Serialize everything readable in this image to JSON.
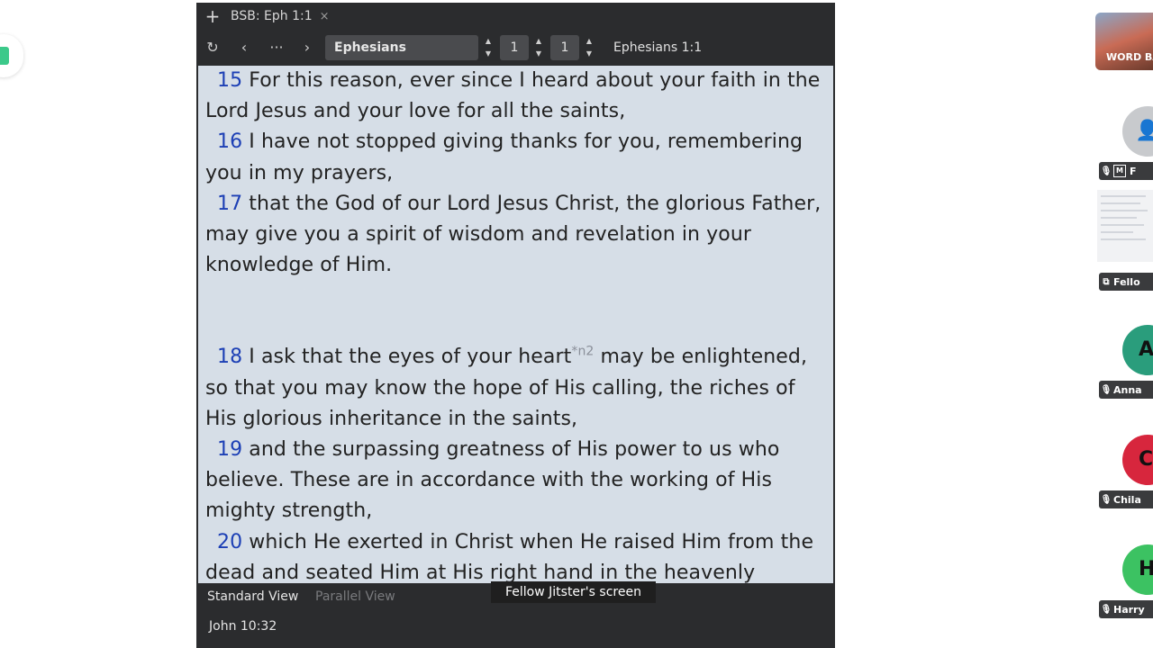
{
  "tab": {
    "title": "BSB: Eph 1:1",
    "close": "×",
    "new": "+"
  },
  "toolbar": {
    "book": "Ephesians",
    "chapter": "1",
    "verse": "1",
    "reference": "Ephesians 1:1"
  },
  "passage": {
    "verses": [
      {
        "num": "15",
        "text": "For this reason, ever since I heard about your faith in the Lord Jesus and your love for all the saints,"
      },
      {
        "num": "16",
        "text": "I have not stopped giving thanks for you, remembering you in my prayers,"
      },
      {
        "num": "17",
        "text": "that the God of our Lord Jesus Christ, the glorious Father, may give you a spirit of wisdom and revelation in your knowledge of Him."
      },
      {
        "num": "18",
        "text_before": "I ask that the eyes of your heart",
        "note": "*n2",
        "text_after": " may be enlightened, so that you may know the hope of His calling, the riches of His glorious inheritance in the saints,"
      },
      {
        "num": "19",
        "text": "and the surpassing greatness of His power to us who believe. These are in accordance with the working of His mighty strength,"
      },
      {
        "num": "20",
        "text": "which He exerted in Christ when He raised Him from the dead and seated Him at His right hand in the heavenly"
      }
    ]
  },
  "views": {
    "standard": "Standard View",
    "parallel": "Parallel View"
  },
  "footer_reference": "John 10:32",
  "screen_share_label": "Fellow Jitster's screen",
  "participants": {
    "banner": "WORD BA",
    "tiles": [
      {
        "initial": "",
        "name": "F",
        "color": "#c8cacd"
      },
      {
        "initial": "",
        "name": "Fello",
        "color": "#f1f2f4"
      },
      {
        "initial": "A",
        "name": "Anna",
        "color": "#2a9d7c"
      },
      {
        "initial": "C",
        "name": "Chila",
        "color": "#d7263d"
      },
      {
        "initial": "H",
        "name": "Harry",
        "color": "#3cc262"
      }
    ]
  },
  "colors": {
    "verse_number": "#1c3fb5",
    "reader_bg": "#d6dee7",
    "chrome": "#2b2c2e"
  }
}
